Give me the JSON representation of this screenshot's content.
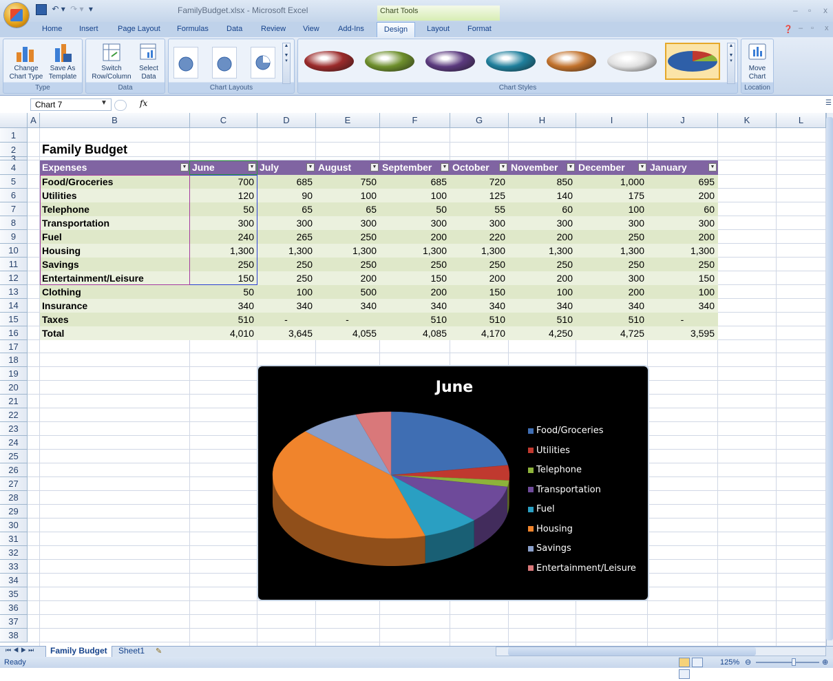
{
  "window": {
    "title": "FamilyBudget.xlsx - Microsoft Excel",
    "context_tab_group": "Chart Tools",
    "controls": [
      "–",
      "▫",
      "x"
    ]
  },
  "ribbon": {
    "tabs": [
      "Home",
      "Insert",
      "Page Layout",
      "Formulas",
      "Data",
      "Review",
      "View",
      "Add-Ins",
      "Design",
      "Layout",
      "Format"
    ],
    "active_tab": "Design",
    "groups": {
      "type": {
        "label": "Type",
        "buttons": [
          "Change Chart Type",
          "Save As Template"
        ]
      },
      "data": {
        "label": "Data",
        "buttons": [
          "Switch Row/Column",
          "Select Data"
        ]
      },
      "layouts": {
        "label": "Chart Layouts"
      },
      "styles": {
        "label": "Chart Styles",
        "colors": [
          "#9b2b2b",
          "#6e8f2c",
          "#5b3a7e",
          "#1f7f9c",
          "#c2722c",
          "#e0e0e0",
          "#2e5fa8"
        ]
      },
      "location": {
        "label": "Location",
        "buttons": [
          "Move Chart"
        ]
      }
    }
  },
  "formula_bar": {
    "name_box": "Chart 7",
    "fx": "fx",
    "value": ""
  },
  "sheet": {
    "columns": [
      "A",
      "B",
      "C",
      "D",
      "E",
      "F",
      "G",
      "H",
      "I",
      "J",
      "K",
      "L"
    ],
    "title": "Family Budget",
    "headers": [
      "Expenses",
      "June",
      "July",
      "August",
      "September",
      "October",
      "November",
      "December",
      "January"
    ],
    "rows": [
      {
        "label": "Food/Groceries",
        "values": [
          "700",
          "685",
          "750",
          "685",
          "720",
          "850",
          "1,000",
          "695"
        ]
      },
      {
        "label": "Utilities",
        "values": [
          "120",
          "90",
          "100",
          "100",
          "125",
          "140",
          "175",
          "200"
        ]
      },
      {
        "label": "Telephone",
        "values": [
          "50",
          "65",
          "65",
          "50",
          "55",
          "60",
          "100",
          "60"
        ]
      },
      {
        "label": "Transportation",
        "values": [
          "300",
          "300",
          "300",
          "300",
          "300",
          "300",
          "300",
          "300"
        ]
      },
      {
        "label": "Fuel",
        "values": [
          "240",
          "265",
          "250",
          "200",
          "220",
          "200",
          "250",
          "200"
        ]
      },
      {
        "label": "Housing",
        "values": [
          "1,300",
          "1,300",
          "1,300",
          "1,300",
          "1,300",
          "1,300",
          "1,300",
          "1,300"
        ]
      },
      {
        "label": "Savings",
        "values": [
          "250",
          "250",
          "250",
          "250",
          "250",
          "250",
          "250",
          "250"
        ]
      },
      {
        "label": "Entertainment/Leisure",
        "values": [
          "150",
          "250",
          "200",
          "150",
          "200",
          "200",
          "300",
          "150"
        ]
      },
      {
        "label": "Clothing",
        "values": [
          "50",
          "100",
          "500",
          "200",
          "150",
          "100",
          "200",
          "100"
        ]
      },
      {
        "label": "Insurance",
        "values": [
          "340",
          "340",
          "340",
          "340",
          "340",
          "340",
          "340",
          "340"
        ]
      },
      {
        "label": "Taxes",
        "values": [
          "510",
          "-",
          "-",
          "510",
          "510",
          "510",
          "510",
          "-"
        ]
      },
      {
        "label": "Total",
        "values": [
          "4,010",
          "3,645",
          "4,055",
          "4,085",
          "4,170",
          "4,250",
          "4,725",
          "3,595"
        ]
      }
    ],
    "row_numbers": [
      "1",
      "2",
      "3",
      "4",
      "5",
      "6",
      "7",
      "8",
      "9",
      "10",
      "11",
      "12",
      "13",
      "14",
      "15",
      "16",
      "17",
      "18",
      "19",
      "20",
      "21",
      "22",
      "23",
      "24",
      "25",
      "26",
      "27",
      "28",
      "29",
      "30",
      "31",
      "32",
      "33",
      "34",
      "35",
      "36",
      "37",
      "38"
    ],
    "tabs": [
      "Family Budget",
      "Sheet1"
    ],
    "active_tab": "Family Budget"
  },
  "status_bar": {
    "status": "Ready",
    "zoom": "125%"
  },
  "chart_data": {
    "type": "pie",
    "title": "June",
    "categories": [
      "Food/Groceries",
      "Utilities",
      "Telephone",
      "Transportation",
      "Fuel",
      "Housing",
      "Savings",
      "Entertainment/Leisure"
    ],
    "values": [
      700,
      120,
      50,
      300,
      240,
      1300,
      250,
      150
    ],
    "colors": [
      "#3f6eb3",
      "#c0392f",
      "#8db33a",
      "#6e4a9a",
      "#2a9fc2",
      "#f0842c",
      "#8a9fc9",
      "#d9787a"
    ],
    "legend_position": "right",
    "style": "3d"
  }
}
